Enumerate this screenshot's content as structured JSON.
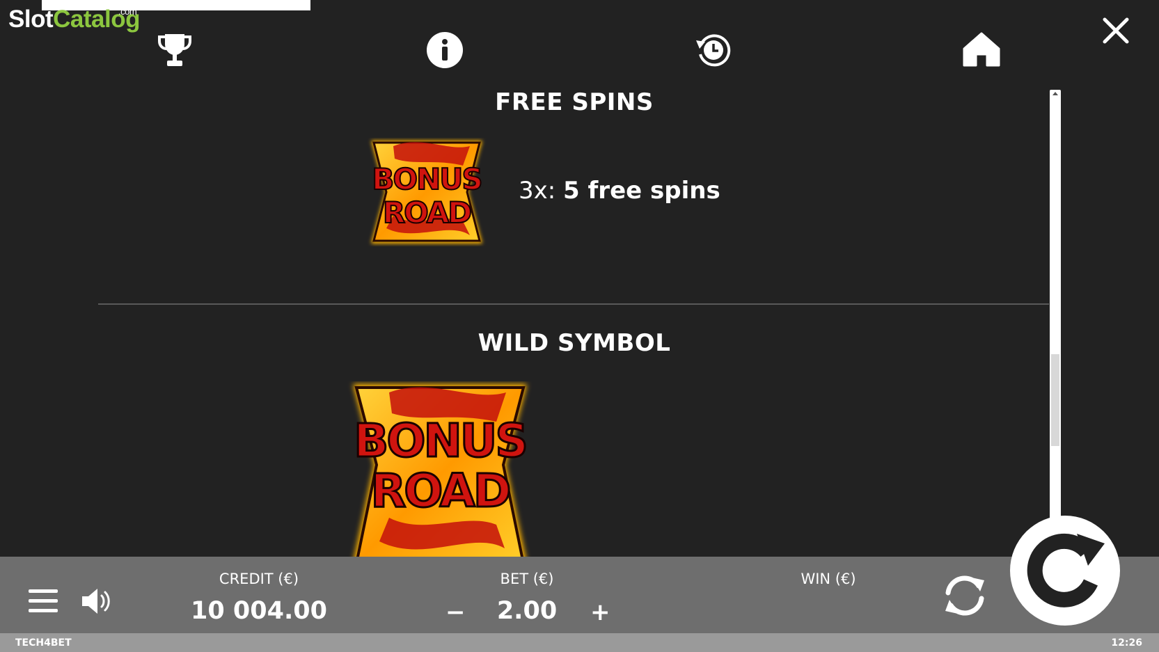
{
  "logo": {
    "slot": "Slot",
    "catalog": "Catalog",
    "com": ".com"
  },
  "nav": {
    "icons": [
      "trophy-icon",
      "info-icon",
      "history-icon",
      "home-icon",
      "close-icon"
    ]
  },
  "paytable": {
    "free_spins": {
      "title": "FREE SPINS",
      "symbol_text": [
        "BONUS",
        "ROAD"
      ],
      "pay_prefix": "3x: ",
      "pay_value": "5 free spins"
    },
    "wild_symbol": {
      "title": "WILD SYMBOL",
      "symbol_text": [
        "BONUS",
        "ROAD"
      ]
    }
  },
  "bottom_bar": {
    "credit_label": "CREDIT (€)",
    "credit_value": "10 004.00",
    "bet_label": "BET (€)",
    "bet_value": "2.00",
    "bet_minus": "−",
    "bet_plus": "+",
    "win_label": "WIN (€)",
    "win_value": ""
  },
  "status_bar": {
    "provider": "TECH4BET",
    "time": "12:26"
  },
  "colors": {
    "background": "#222222",
    "bottom_bar": "#6e6e6e",
    "status_bar": "#9a9a9a",
    "logo_green": "#8cc63f",
    "symbol_red": "#d0140f",
    "symbol_gold": "#ffb400"
  }
}
